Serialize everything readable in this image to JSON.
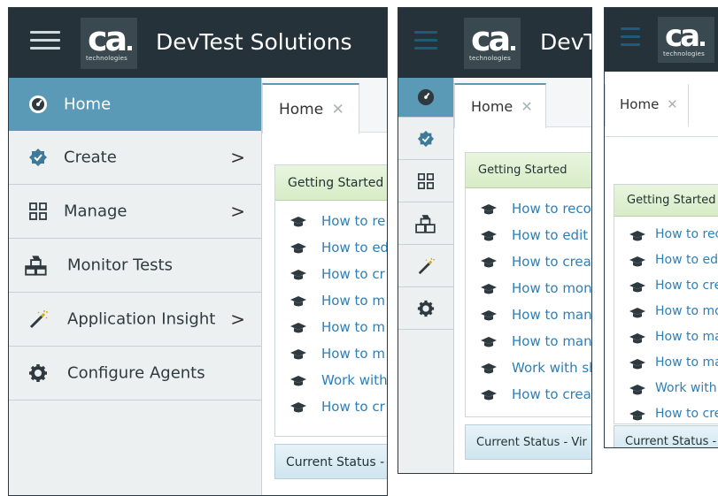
{
  "app": {
    "brand": "ca",
    "brand_sub": "technologies",
    "title": "DevTest Solutions"
  },
  "nav": {
    "items": [
      {
        "label": "Home",
        "icon": "dashboard-icon",
        "active": true,
        "chevron": ""
      },
      {
        "label": "Create",
        "icon": "badge-check-icon",
        "active": false,
        "chevron": ">"
      },
      {
        "label": "Manage",
        "icon": "grid-icon",
        "active": false,
        "chevron": ">"
      },
      {
        "label": "Monitor Tests",
        "icon": "boxes-icon",
        "active": false,
        "chevron": ""
      },
      {
        "label": "Application Insight",
        "icon": "magic-wand-icon",
        "active": false,
        "chevron": ">"
      },
      {
        "label": "Configure Agents",
        "icon": "gear-icon",
        "active": false,
        "chevron": ""
      }
    ]
  },
  "tab": {
    "label": "Home",
    "close": "✕"
  },
  "panels": {
    "p1": {
      "header": "Getting Started",
      "links": [
        "How to re",
        "How to ed",
        "How to cr",
        "How to m",
        "How to m",
        "How to m",
        "Work with",
        "How to cr"
      ],
      "status": "Current Status -"
    },
    "p2": {
      "header": "Getting Started",
      "links": [
        "How to recor",
        "How to edit a",
        "How to create",
        "How to monit",
        "How to mana",
        "How to mana",
        "Work with sh",
        "How to creat"
      ],
      "status": "Current Status - Vir"
    },
    "p3": {
      "header": "Getting Started",
      "links": [
        "How to rec",
        "How to ed",
        "How to cre",
        "How to mo",
        "How to ma",
        "How to ma",
        "Work with",
        "How to cre"
      ],
      "status": "Current Status -"
    }
  },
  "colors": {
    "topbar": "#253239",
    "nav_active": "#5a9ab7",
    "link": "#2d7fb8",
    "header_green": "#d7ecc6",
    "status_blue": "#cfe5ef"
  }
}
